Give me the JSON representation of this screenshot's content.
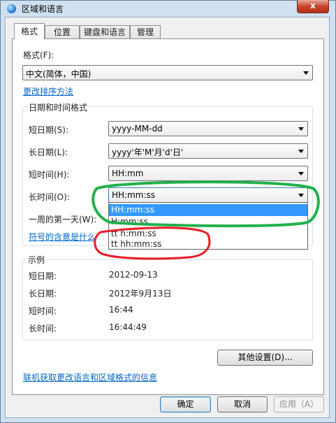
{
  "window": {
    "title": "区域和语言",
    "close_glyph": "x"
  },
  "tabs": [
    {
      "label": "格式",
      "active": true
    },
    {
      "label": "位置",
      "active": false
    },
    {
      "label": "键盘和语言",
      "active": false
    },
    {
      "label": "管理",
      "active": false
    }
  ],
  "format": {
    "label": "格式(F):",
    "value": "中文(简体，中国)",
    "change_sort_link": "更改排序方法"
  },
  "datetime": {
    "group_title": "日期和时间格式",
    "short_date": {
      "label": "短日期(S):",
      "value": "yyyy-MM-dd"
    },
    "long_date": {
      "label": "长日期(L):",
      "value": "yyyy'年'M'月'd'日'"
    },
    "short_time": {
      "label": "短时间(H):",
      "value": "HH:mm"
    },
    "long_time": {
      "label": "长时间(O):",
      "value": "HH:mm:ss"
    },
    "first_day_label": "一周的第一天(W):",
    "symbols_link": "符号的含意是什么",
    "long_time_options": [
      "HH:mm:ss",
      "H:mm:ss",
      "tt h:mm:ss",
      "tt hh:mm:ss"
    ]
  },
  "examples": {
    "group_title": "示例",
    "rows": [
      {
        "label": "短日期:",
        "value": "2012-09-13"
      },
      {
        "label": "长日期:",
        "value": "2012年9月13日"
      },
      {
        "label": "短时间:",
        "value": "16:44"
      },
      {
        "label": "长时间:",
        "value": "16:44:49"
      }
    ]
  },
  "other_settings_button": "其他设置(D)...",
  "online_info_link": "联机获取更改语言和区域格式的信息",
  "buttons": {
    "ok": "确定",
    "cancel": "取消",
    "apply": "应用（A）"
  },
  "annotations": {
    "green_ellipse_color": "#22b14c",
    "red_ellipse_color": "#e81c24"
  }
}
